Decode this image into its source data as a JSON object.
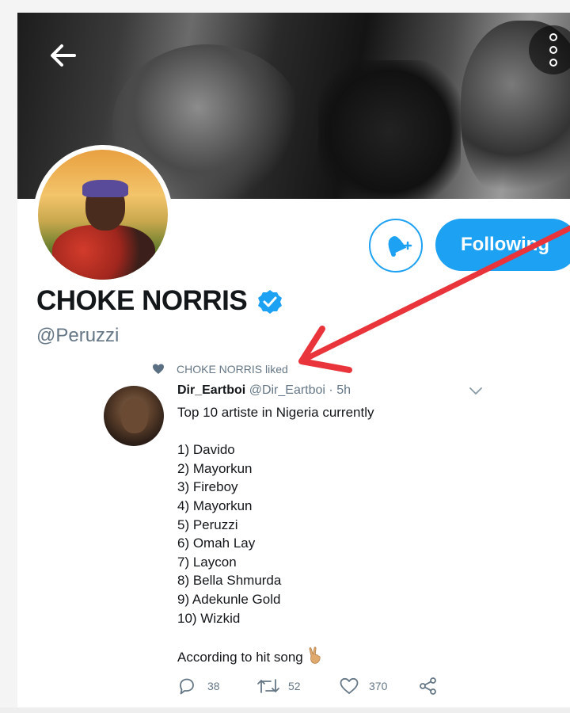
{
  "profile": {
    "display_name": "CHOKE NORRIS",
    "handle": "@Peruzzi",
    "verified": true,
    "following_label": "Following"
  },
  "liked_banner": {
    "text": "CHOKE NORRIS liked"
  },
  "tweet": {
    "author": "Dir_Eartboi",
    "meta": "@Dir_Eartboi · 5h",
    "intro": "Top 10 artiste in Nigeria currently",
    "list": [
      "1) Davido",
      "2) Mayorkun",
      "3) Fireboy",
      "4) Mayorkun",
      "5) Peruzzi",
      "6) Omah Lay",
      "7) Laycon",
      "8) Bella Shmurda",
      "9) Adekunle Gold",
      "10) Wizkid"
    ],
    "outro": "According to hit song",
    "replies": "38",
    "retweets": "52",
    "likes": "370"
  },
  "icons": {
    "back": "arrow-left-icon",
    "more": "more-vertical-icon",
    "bell": "bell-plus-icon",
    "verified": "verified-badge-icon",
    "heart": "heart-icon",
    "reply": "reply-icon",
    "retweet": "retweet-icon",
    "share": "share-icon",
    "victory_emoji": "victory-hand-emoji"
  },
  "colors": {
    "accent": "#1da1f2",
    "annotation_arrow": "#e8343a",
    "secondary_text": "#657786"
  }
}
